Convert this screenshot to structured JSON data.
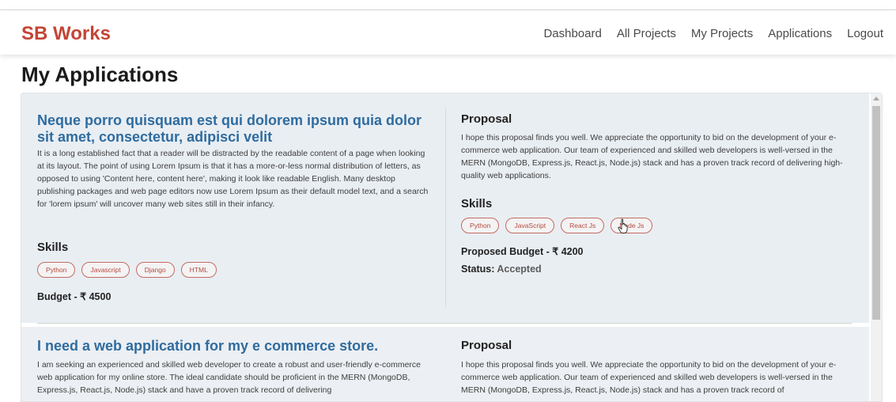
{
  "navbar": {
    "brand": "SB Works",
    "links": [
      "Dashboard",
      "All Projects",
      "My Projects",
      "Applications",
      "Logout"
    ]
  },
  "page": {
    "title": "My Applications"
  },
  "applications": [
    {
      "project_title": "Neque porro quisquam est qui dolorem ipsum quia dolor sit amet, consectetur, adipisci velit",
      "description": "It is a long established fact that a reader will be distracted by the readable content of a page when looking at its layout. The point of using Lorem Ipsum is that it has a more-or-less normal distribution of letters, as opposed to using 'Content here, content here', making it look like readable English. Many desktop publishing packages and web page editors now use Lorem Ipsum as their default model text, and a search for 'lorem ipsum' will uncover many web sites still in their infancy.",
      "skills_heading": "Skills",
      "skills": [
        "Python",
        "Javascript",
        "Django",
        "HTML"
      ],
      "budget": "Budget - ₹ 4500",
      "proposal_heading": "Proposal",
      "proposal": "I hope this proposal finds you well. We appreciate the opportunity to bid on the development of your e-commerce web application. Our team of experienced and skilled web developers is well-versed in the MERN (MongoDB, Express.js, React.js, Node.js) stack and has a proven track record of delivering high-quality web applications.",
      "proposal_skills_heading": "Skills",
      "proposal_skills": [
        "Python",
        "JavaScript",
        "React Js",
        "Node Js"
      ],
      "proposed_budget": "Proposed Budget - ₹ 4200",
      "status_label": "Status:",
      "status_value": "Accepted"
    },
    {
      "project_title": "I need a web application for my e commerce store.",
      "description": "I am seeking an experienced and skilled web developer to create a robust and user-friendly e-commerce web application for my online store. The ideal candidate should be proficient in the MERN (MongoDB, Express.js, React.js, Node.js) stack and have a proven track record of delivering",
      "proposal_heading": "Proposal",
      "proposal": "I hope this proposal finds you well. We appreciate the opportunity to bid on the development of your e-commerce web application. Our team of experienced and skilled web developers is well-versed in the MERN (MongoDB, Express.js, React.js, Node.js) stack and has a proven track record of"
    }
  ],
  "colors": {
    "brand": "#c44535",
    "project_title": "#2f6c9f",
    "chip_border": "#c66b60",
    "card_bg": "#e9eef3"
  }
}
